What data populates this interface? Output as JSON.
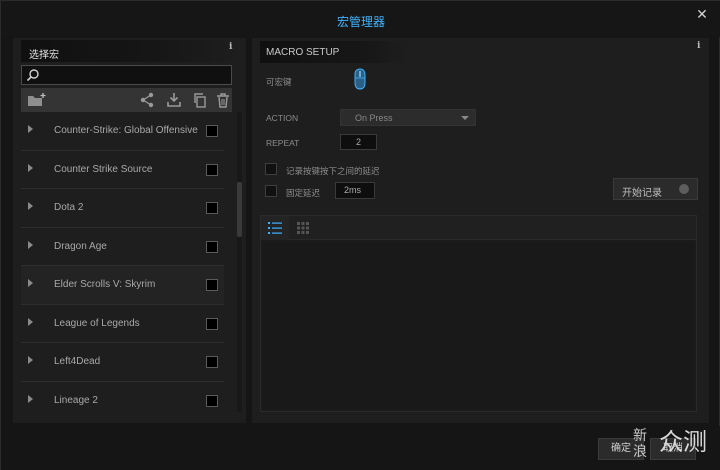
{
  "window": {
    "title": "宏管理器",
    "close_glyph": "✕"
  },
  "left_panel": {
    "title": "选择宏",
    "info": "i",
    "search": {
      "placeholder": "",
      "value": ""
    },
    "toolbar": [
      "add-folder-icon",
      "share-icon",
      "download-icon",
      "copy-icon",
      "trash-icon"
    ],
    "items": [
      {
        "label": "Counter-Strike: Global Offensive"
      },
      {
        "label": "Counter Strike Source"
      },
      {
        "label": "Dota 2"
      },
      {
        "label": "Dragon Age"
      },
      {
        "label": "Elder Scrolls V: Skyrim"
      },
      {
        "label": "League of Legends"
      },
      {
        "label": "Left4Dead"
      },
      {
        "label": "Lineage 2"
      }
    ]
  },
  "right_panel": {
    "title": "MACRO SETUP",
    "info": "i",
    "keys_label": "可宏键",
    "action": {
      "label": "ACTION",
      "value": "On Press"
    },
    "repeat": {
      "label": "REPEAT",
      "value": "2"
    },
    "record_delay_label": "记录按键按下之间的延迟",
    "fixed_delay_label": "固定延迟",
    "fixed_delay_value": "2ms",
    "record_button": "开始记录"
  },
  "footer": {
    "ok": "确定",
    "cancel": "取消",
    "watermark_top": "新\n浪",
    "watermark_bottom": "众测"
  },
  "colors": {
    "accent": "#3fb3ff",
    "background": "#151515",
    "panel": "#1e1e1e"
  }
}
